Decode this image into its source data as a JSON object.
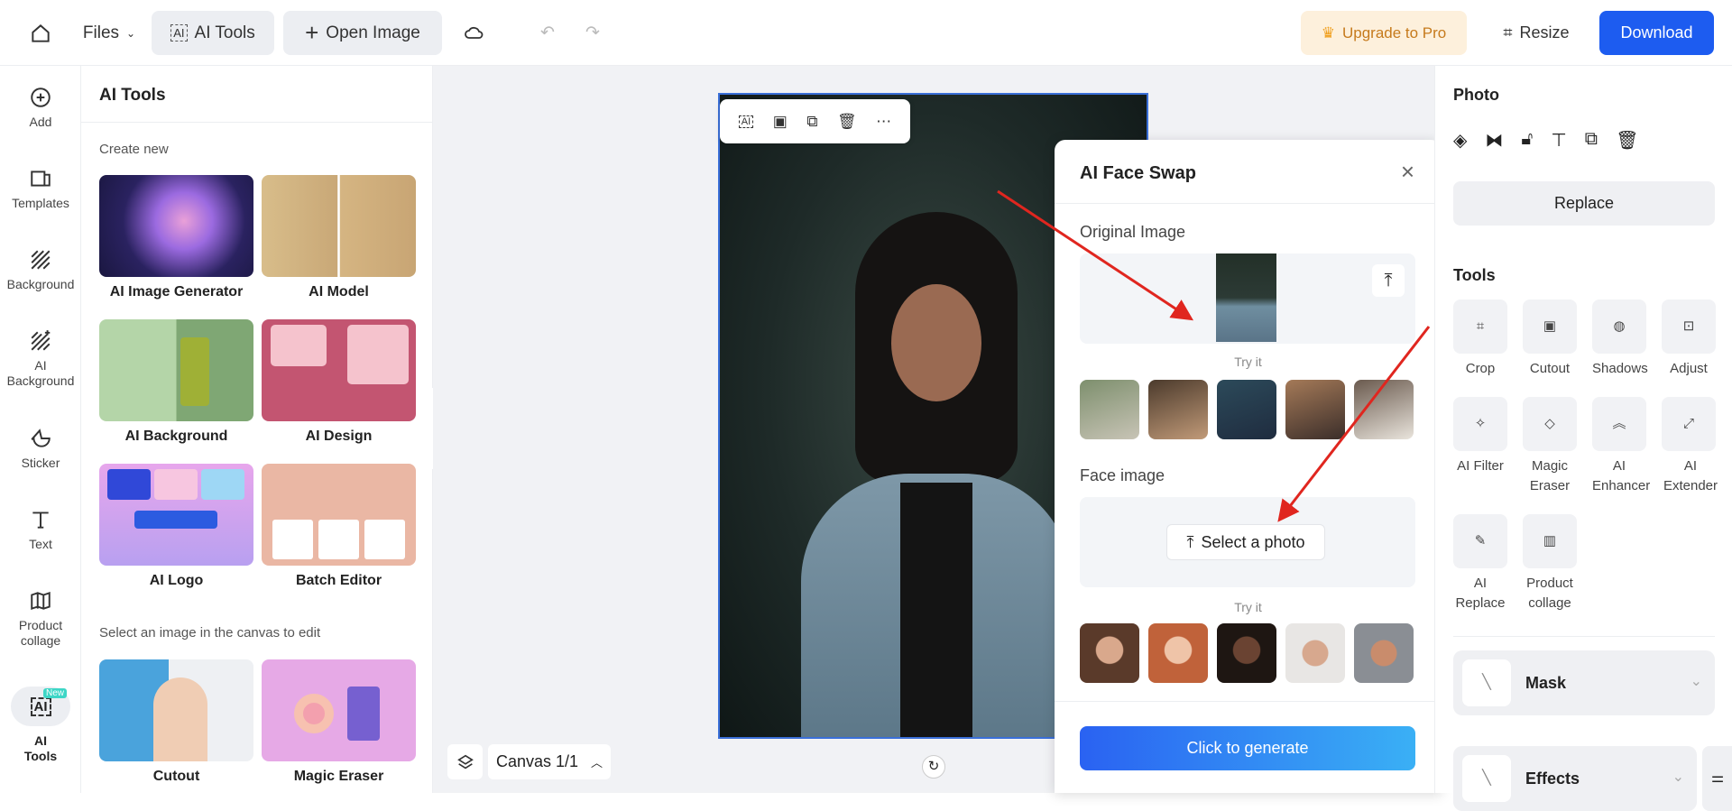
{
  "topbar": {
    "files": "Files",
    "ai_tools": "AI Tools",
    "open_image": "Open Image",
    "upgrade": "Upgrade to Pro",
    "resize": "Resize",
    "download": "Download",
    "colors": {
      "download": "#1d5cf0",
      "upgrade_bg": "#fdf0dc",
      "upgrade_text": "#c67a1c"
    }
  },
  "rail": [
    {
      "label": "Add",
      "icon": "plus-circle-icon"
    },
    {
      "label": "Templates",
      "icon": "templates-icon"
    },
    {
      "label": "Background",
      "icon": "hatch-icon"
    },
    {
      "label": "AI Background",
      "icon": "ai-hatch-icon"
    },
    {
      "label": "Sticker",
      "icon": "sticker-icon"
    },
    {
      "label": "Text",
      "icon": "text-icon"
    },
    {
      "label": "Product collage",
      "icon": "collage-icon"
    },
    {
      "label": "AI Tools",
      "icon": "ai-icon",
      "badge": "New",
      "active": true
    }
  ],
  "panel": {
    "title": "AI Tools",
    "create_new": "Create new",
    "select_hint": "Select an image in the canvas to edit",
    "cards": [
      {
        "label": "AI Image Generator"
      },
      {
        "label": "AI Model"
      },
      {
        "label": "AI Background"
      },
      {
        "label": "AI Design"
      },
      {
        "label": "AI Logo"
      },
      {
        "label": "Batch Editor"
      },
      {
        "label": "Cutout"
      },
      {
        "label": "Magic Eraser"
      }
    ]
  },
  "canvas": {
    "page_label": "Canvas 1/1"
  },
  "face_swap": {
    "title": "AI Face Swap",
    "original_label": "Original Image",
    "try_it": "Try it",
    "face_label": "Face image",
    "select_photo": "Select a photo",
    "generate": "Click to generate"
  },
  "right": {
    "title": "Photo",
    "replace": "Replace",
    "tools_title": "Tools",
    "tools": [
      {
        "label": "Crop"
      },
      {
        "label": "Cutout"
      },
      {
        "label": "Shadows"
      },
      {
        "label": "Adjust"
      },
      {
        "label": "AI Filter"
      },
      {
        "label": "Magic Eraser"
      },
      {
        "label": "AI Enhancer"
      },
      {
        "label": "AI Extender"
      },
      {
        "label": "AI Replace"
      },
      {
        "label": "Product collage"
      }
    ],
    "mask": "Mask",
    "effects": "Effects"
  }
}
